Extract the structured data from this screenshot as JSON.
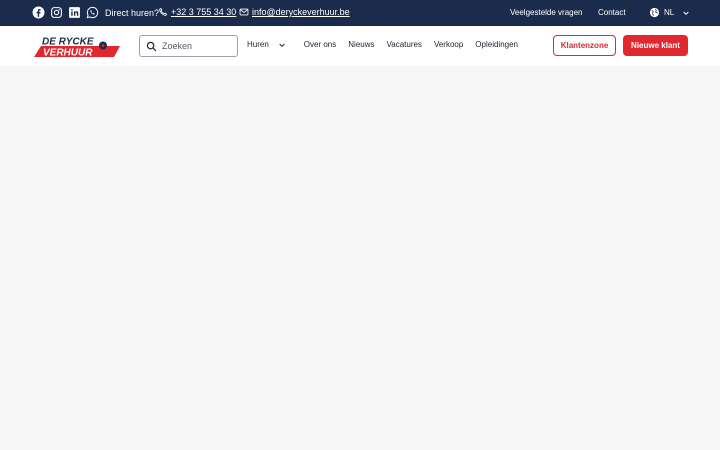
{
  "topbar": {
    "direct_label": "Direct huren?",
    "phone": "+32 3 755 34 30",
    "email": "info@deryckeverhuur.be",
    "faq_label": "Veelgestelde vragen",
    "contact_label": "Contact",
    "language": "NL",
    "background_color": "#1a2b4c"
  },
  "brand": {
    "logo_line1": "DE RYCKE",
    "logo_line2": "VERHUUR",
    "accent_color": "#e0282e"
  },
  "search": {
    "placeholder": "Zoeken"
  },
  "nav": {
    "items": [
      "Huren",
      "Over ons",
      "Nieuws",
      "Vacatures",
      "Verkoop",
      "Opleidingen"
    ]
  },
  "buttons": {
    "client_zone": "Klantenzone",
    "new_client": "Nieuwe klant"
  },
  "icons": [
    "facebook-icon",
    "instagram-icon",
    "linkedin-icon",
    "whatsapp-icon",
    "phone-icon",
    "mail-icon",
    "globe-icon",
    "chevron-down-icon",
    "search-icon"
  ]
}
